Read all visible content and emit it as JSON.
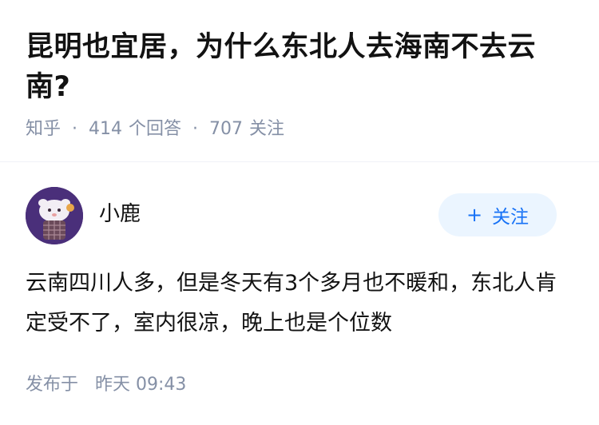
{
  "question": {
    "title": "昆明也宜居，为什么东北人去海南不去云南?",
    "source": "知乎",
    "answer_count": "414",
    "answer_label": "个回答",
    "follower_count": "707",
    "follower_label": "关注"
  },
  "answer": {
    "author_name": "小鹿",
    "follow_label": "关注",
    "content": "云南四川人多，但是冬天有3个多月也不暖和，东北人肯定受不了，室内很凉，晚上也是个位数",
    "published_label": "发布于",
    "published_time": "昨天 09:43"
  },
  "colors": {
    "accent": "#1772f6",
    "follow_bg": "#ebf5ff",
    "meta_text": "#8590a6",
    "avatar_bg": "#4a2f7a"
  }
}
